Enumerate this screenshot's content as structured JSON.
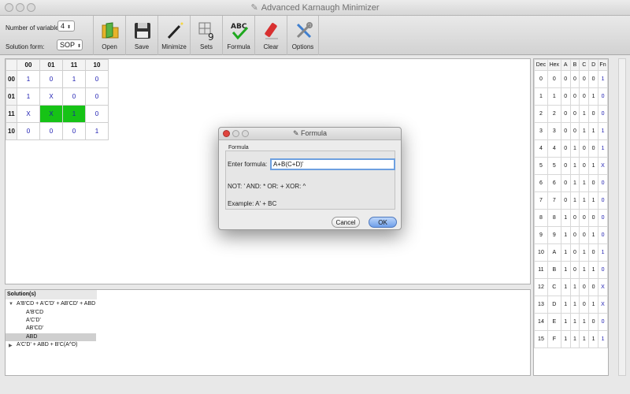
{
  "window": {
    "title": "Advanced Karnaugh Minimizer"
  },
  "toolbar": {
    "num_vars_label": "Number of variables:",
    "num_vars_value": "4",
    "form_label": "Solution form:",
    "form_value": "SOP",
    "buttons": [
      "Open",
      "Save",
      "Minimize",
      "Sets",
      "Formula",
      "Clear",
      "Options"
    ]
  },
  "kmap": {
    "cols": [
      "00",
      "01",
      "11",
      "10"
    ],
    "rows": [
      {
        "h": "00",
        "cells": [
          "1",
          "0",
          "1",
          "0"
        ]
      },
      {
        "h": "01",
        "cells": [
          "1",
          "X",
          "0",
          "0"
        ]
      },
      {
        "h": "11",
        "cells": [
          "X",
          "X",
          "1",
          "0"
        ]
      },
      {
        "h": "10",
        "cells": [
          "0",
          "0",
          "0",
          "1"
        ]
      }
    ]
  },
  "solutions": {
    "header": "Solution(s)",
    "first": "A'B'CD + A'C'D' + AB'CD' + ABD",
    "children": [
      "A'B'CD",
      "A'C'D'",
      "AB'CD'",
      "ABD"
    ],
    "second": "A'C'D'  +  ABD + B'C(A^D)"
  },
  "truth": {
    "headers": [
      "Dec",
      "Hex",
      "A",
      "B",
      "C",
      "D",
      "Fn"
    ],
    "rows": [
      [
        "0",
        "0",
        "0",
        "0",
        "0",
        "0",
        "1"
      ],
      [
        "1",
        "1",
        "0",
        "0",
        "0",
        "1",
        "0"
      ],
      [
        "2",
        "2",
        "0",
        "0",
        "1",
        "0",
        "0"
      ],
      [
        "3",
        "3",
        "0",
        "0",
        "1",
        "1",
        "1"
      ],
      [
        "4",
        "4",
        "0",
        "1",
        "0",
        "0",
        "1"
      ],
      [
        "5",
        "5",
        "0",
        "1",
        "0",
        "1",
        "X"
      ],
      [
        "6",
        "6",
        "0",
        "1",
        "1",
        "0",
        "0"
      ],
      [
        "7",
        "7",
        "0",
        "1",
        "1",
        "1",
        "0"
      ],
      [
        "8",
        "8",
        "1",
        "0",
        "0",
        "0",
        "0"
      ],
      [
        "9",
        "9",
        "1",
        "0",
        "0",
        "1",
        "0"
      ],
      [
        "10",
        "A",
        "1",
        "0",
        "1",
        "0",
        "1"
      ],
      [
        "11",
        "B",
        "1",
        "0",
        "1",
        "1",
        "0"
      ],
      [
        "12",
        "C",
        "1",
        "1",
        "0",
        "0",
        "X"
      ],
      [
        "13",
        "D",
        "1",
        "1",
        "0",
        "1",
        "X"
      ],
      [
        "14",
        "E",
        "1",
        "1",
        "1",
        "0",
        "0"
      ],
      [
        "15",
        "F",
        "1",
        "1",
        "1",
        "1",
        "1"
      ]
    ]
  },
  "dialog": {
    "title": "Formula",
    "group_label": "Formula",
    "enter_label": "Enter formula:",
    "formula_value": "A+B(C+D)'",
    "ops": "NOT: '   AND: *  OR: +    XOR: ^",
    "example": "Example: A' + BC",
    "cancel": "Cancel",
    "ok": "OK"
  },
  "colors": {
    "accent": "#16c316",
    "value_blue": "#1a1ab0",
    "ok_blue": "#6f9fe9"
  }
}
